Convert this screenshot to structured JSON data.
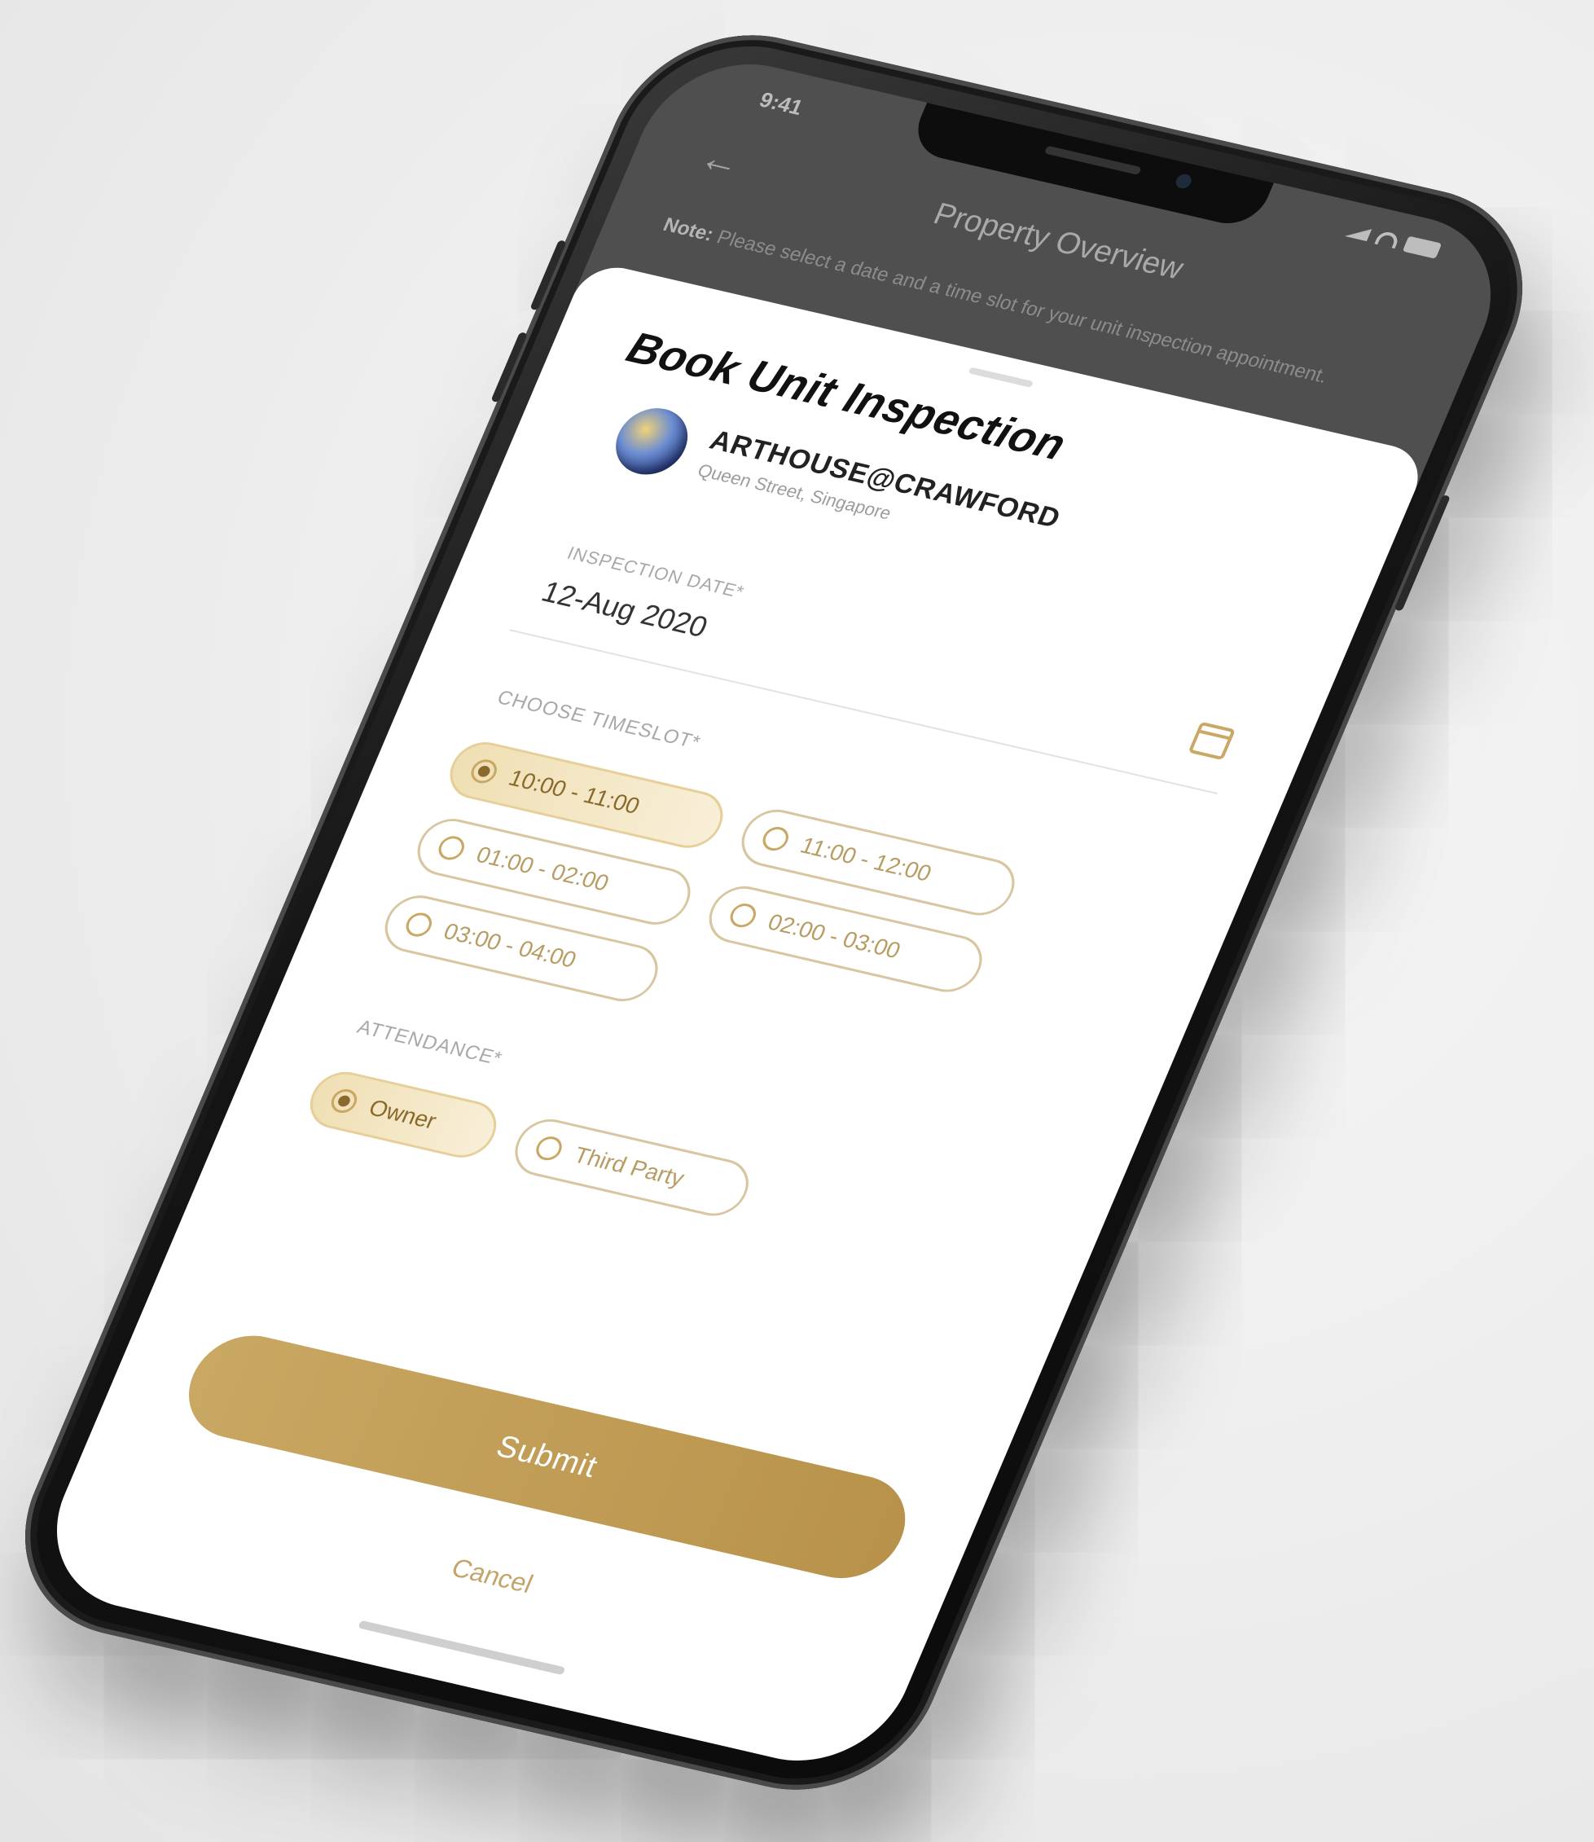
{
  "status_bar": {
    "time": "9:41"
  },
  "header": {
    "back_icon": "arrow-left-icon",
    "title": "Property Overview"
  },
  "notice": {
    "bold": "Note:",
    "text": " Please select a date and a time slot for your unit inspection appointment."
  },
  "sheet": {
    "title": "Book Unit Inspection",
    "project_name": "ARTHOUSE@CRAWFORD",
    "project_sub": "Queen Street, Singapore",
    "field_label": "INSPECTION DATE*",
    "field_value": "12-Aug 2020",
    "calendar_icon": "calendar-icon",
    "timeslot_label": "CHOOSE TIMESLOT*",
    "timeslots": [
      {
        "label": "10:00 - 11:00",
        "selected": true
      },
      {
        "label": "11:00 - 12:00",
        "selected": false
      },
      {
        "label": "01:00 - 02:00",
        "selected": false
      },
      {
        "label": "02:00 - 03:00",
        "selected": false
      },
      {
        "label": "03:00 - 04:00",
        "selected": false
      }
    ],
    "attendance_label": "ATTENDANCE*",
    "attendance": [
      {
        "label": "Owner",
        "selected": true
      },
      {
        "label": "Third Party",
        "selected": false
      }
    ],
    "submit_label": "Submit",
    "cancel_label": "Cancel"
  },
  "colors": {
    "accent_gold": "#b8924a",
    "chip_selected_bg": "#f0dfb4",
    "chip_border": "#d7c6a0"
  }
}
